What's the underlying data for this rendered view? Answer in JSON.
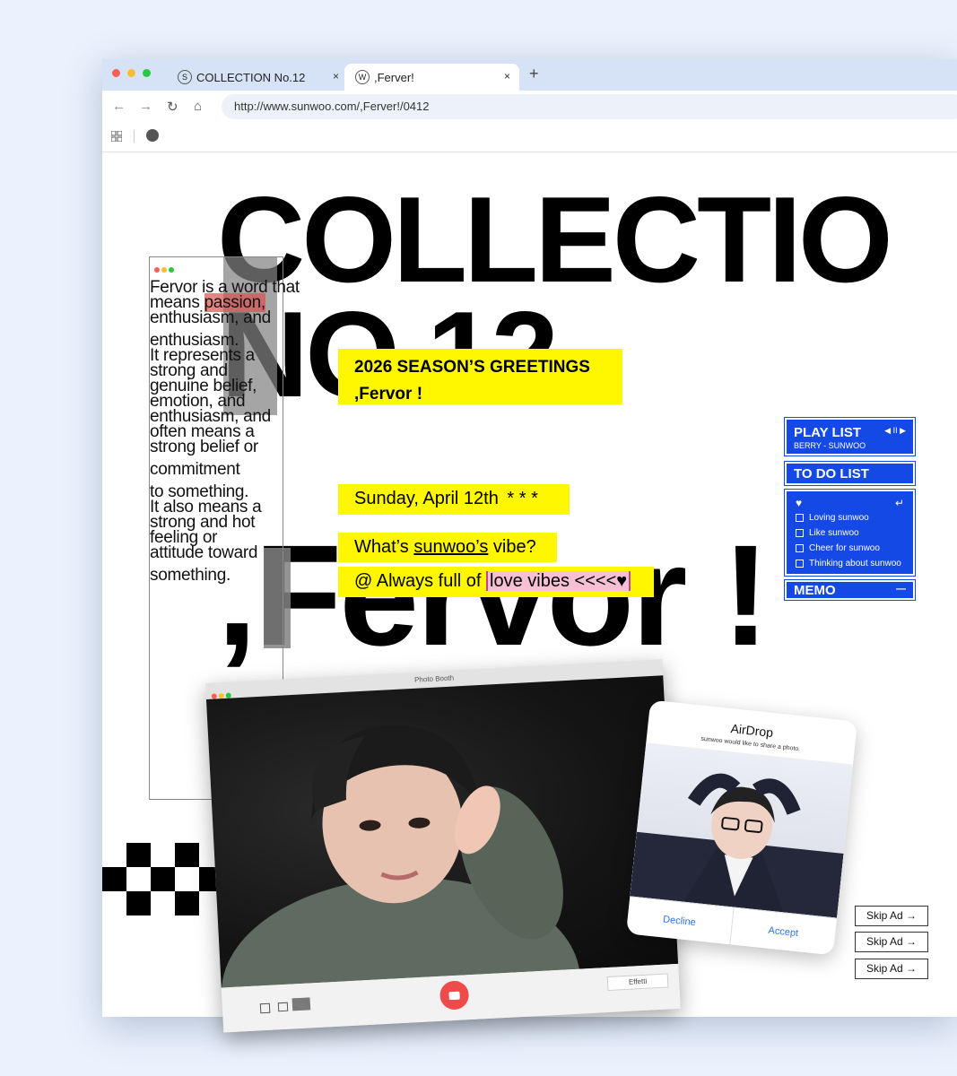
{
  "browser": {
    "tabs": [
      {
        "favicon": "S",
        "label": "COLLECTION No.12"
      },
      {
        "favicon": "W",
        "label": ",Ferver!"
      }
    ],
    "new_tab": "+",
    "close": "×",
    "url": "http://www.sunwoo.com/,Ferver!/0412"
  },
  "title": {
    "line1": "COLLECTIO",
    "line2": "NO.12",
    "fervor": ",Fervor !"
  },
  "panel": {
    "p1": "Fervor is a word that means ",
    "highlight": "passion,",
    "p2": " enthusiasm, and",
    "p3": "enthusiasm.",
    "p4": "It represents a strong and genuine belief, emotion, and enthusiasm, and often means a strong belief or",
    "p5": "commitment",
    "p6": "to something.",
    "p7": "It also means a strong and hot feeling or attitude toward",
    "p8": "something."
  },
  "greetings": {
    "season": "2026 SEASON’S GREETINGS",
    "fervor": ",Fervor !",
    "date": "Sunday, April 12th",
    "stars": "* * *",
    "question_pre": "What’s ",
    "question_link": "sunwoo’s",
    "question_post": " vibe?",
    "answer_pre": "@ Always full of ",
    "answer_hl": "love vibes <<<<",
    "heart": "♥"
  },
  "playlist": {
    "title": "PLAY LIST",
    "track": "BERRY - SUNWOO",
    "controls": "◀ II ▶"
  },
  "todo": {
    "title": "TO DO LIST",
    "heart": "♥",
    "enter": "↵",
    "items": [
      "Loving sunwoo",
      "Like sunwoo",
      "Cheer for sunwoo",
      "Thinking about sunwoo"
    ]
  },
  "memo": {
    "title": "MEMO",
    "minus": "—"
  },
  "photobooth": {
    "title": "Photo Booth",
    "effects": "Effetti"
  },
  "airdrop": {
    "title": "AirDrop",
    "subtitle": "sunwoo would like to share a photo.",
    "decline": "Decline",
    "accept": "Accept"
  },
  "ads": [
    "Skip Ad →",
    "Skip Ad →",
    "Skip Ad →"
  ],
  "colors": {
    "accent_yellow": "#fff700",
    "widget_blue": "#1549e6",
    "highlight_pink": "#f7bfd3",
    "highlight_red": "#dc5050"
  }
}
